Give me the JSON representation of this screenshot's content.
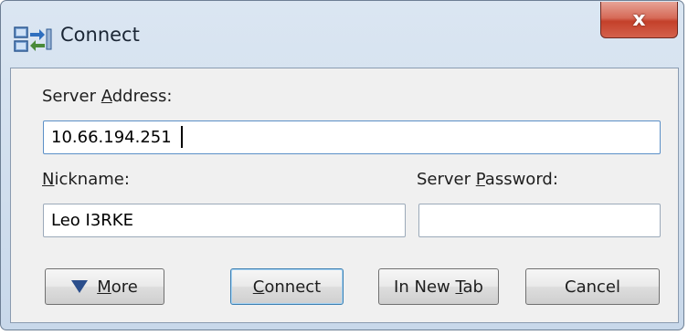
{
  "window": {
    "title": "Connect",
    "close_glyph": "x"
  },
  "form": {
    "server_address_label_pre": "Server ",
    "server_address_label_key": "A",
    "server_address_label_post": "ddress:",
    "server_address_value": "10.66.194.251",
    "nickname_label_key": "N",
    "nickname_label_post": "ickname:",
    "nickname_value": "Leo I3RKE",
    "server_password_label_pre": "Server ",
    "server_password_label_key": "P",
    "server_password_label_post": "assword:",
    "server_password_value": ""
  },
  "buttons": {
    "more_key": "M",
    "more_post": "ore",
    "connect_key": "C",
    "connect_post": "onnect",
    "new_tab_pre": "In New ",
    "new_tab_key": "T",
    "new_tab_post": "ab",
    "cancel": "Cancel"
  },
  "icons": {
    "app": "connect-dialog-icon",
    "close": "close-icon",
    "more": "triangle-down-icon"
  },
  "colors": {
    "close_button": "#c4402a",
    "titlebar": "#dbe6f2",
    "default_button_border": "#3c7fb1",
    "more_triangle": "#2b4e8c"
  }
}
